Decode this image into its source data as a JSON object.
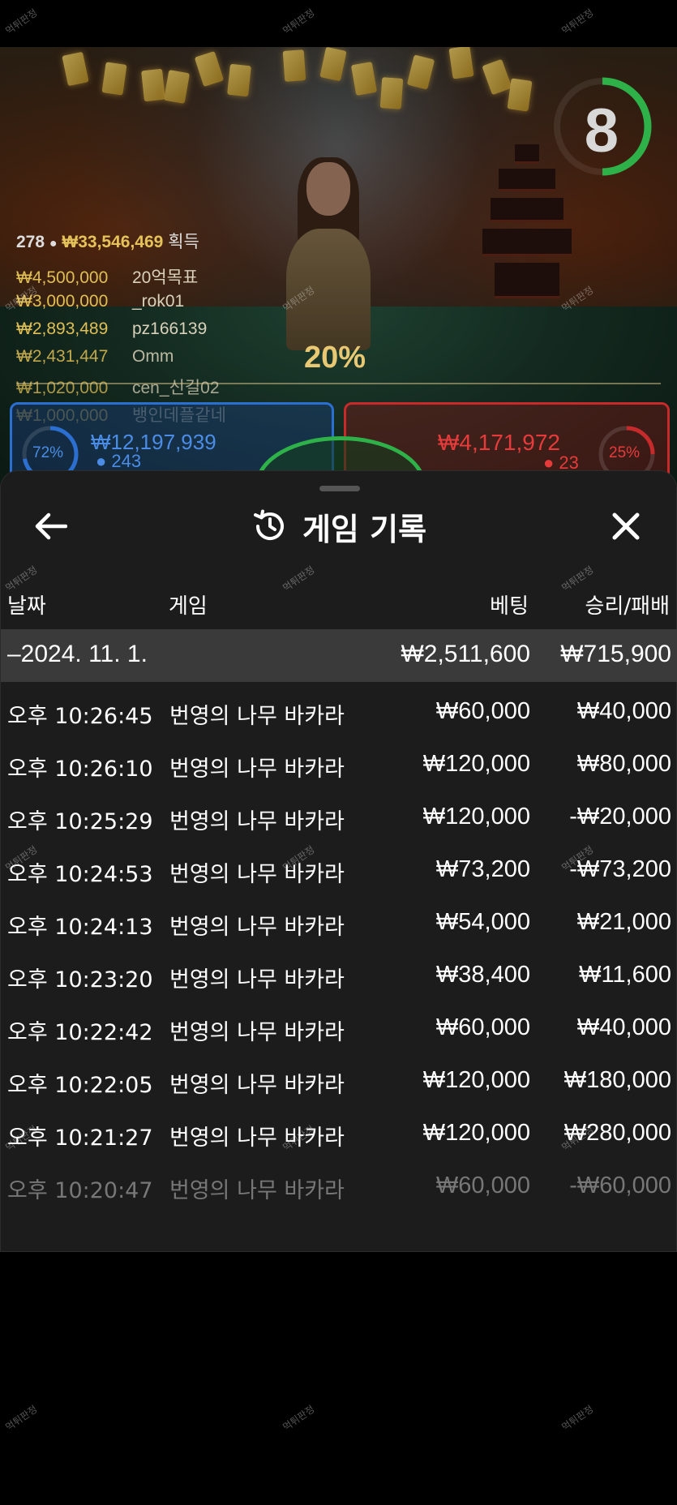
{
  "game_view": {
    "timer_value": "8",
    "summary": {
      "count": "278",
      "total": "₩33,546,469",
      "suffix": "획득"
    },
    "leaderboard": [
      {
        "amount": "₩4,500,000",
        "name": "20억목표"
      },
      {
        "amount": "₩3,000,000",
        "name": "_rok01"
      },
      {
        "amount": "₩2,893,489",
        "name": "pz166139"
      },
      {
        "amount": "₩2,431,447",
        "name": "Omm"
      },
      {
        "amount": "₩1,020,000",
        "name": "cen_신길02"
      },
      {
        "amount": "₩1,000,000",
        "name": "뱅인데플같네"
      }
    ],
    "center_percent": "20%",
    "player_bet": {
      "percent": "72%",
      "amount": "₩12,197,939",
      "count": "243",
      "color": "#2b6fd1"
    },
    "banker_bet": {
      "percent": "25%",
      "amount": "₩4,171,972",
      "count": "23",
      "color": "#c72a2a"
    },
    "tie_color": "#2fb14a"
  },
  "sheet": {
    "title": "게임 기록",
    "title_icon": "history-icon",
    "back_icon": "arrow-left-icon",
    "close_icon": "close-icon",
    "columns": {
      "date": "날짜",
      "game": "게임",
      "bet": "베팅",
      "result": "승리/패배"
    },
    "group": {
      "date": "–2024. 11. 1.",
      "bet_total": "₩2,511,600",
      "result_total": "₩715,900"
    },
    "rows": [
      {
        "time": "오후 10:26:45",
        "game": "번영의 나무 바카라",
        "bet": "₩60,000",
        "result": "₩40,000"
      },
      {
        "time": "오후 10:26:10",
        "game": "번영의 나무 바카라",
        "bet": "₩120,000",
        "result": "₩80,000"
      },
      {
        "time": "오후 10:25:29",
        "game": "번영의 나무 바카라",
        "bet": "₩120,000",
        "result": "-₩20,000"
      },
      {
        "time": "오후 10:24:53",
        "game": "번영의 나무 바카라",
        "bet": "₩73,200",
        "result": "-₩73,200"
      },
      {
        "time": "오후 10:24:13",
        "game": "번영의 나무 바카라",
        "bet": "₩54,000",
        "result": "₩21,000"
      },
      {
        "time": "오후 10:23:20",
        "game": "번영의 나무 바카라",
        "bet": "₩38,400",
        "result": "₩11,600"
      },
      {
        "time": "오후 10:22:42",
        "game": "번영의 나무 바카라",
        "bet": "₩60,000",
        "result": "₩40,000"
      },
      {
        "time": "오후 10:22:05",
        "game": "번영의 나무 바카라",
        "bet": "₩120,000",
        "result": "₩180,000"
      },
      {
        "time": "오후 10:21:27",
        "game": "번영의 나무 바카라",
        "bet": "₩120,000",
        "result": "₩280,000"
      },
      {
        "time": "오후 10:20:47",
        "game": "번영의 나무 바카라",
        "bet": "₩60,000",
        "result": "-₩60,000"
      }
    ]
  },
  "watermark": "먹튀판정"
}
